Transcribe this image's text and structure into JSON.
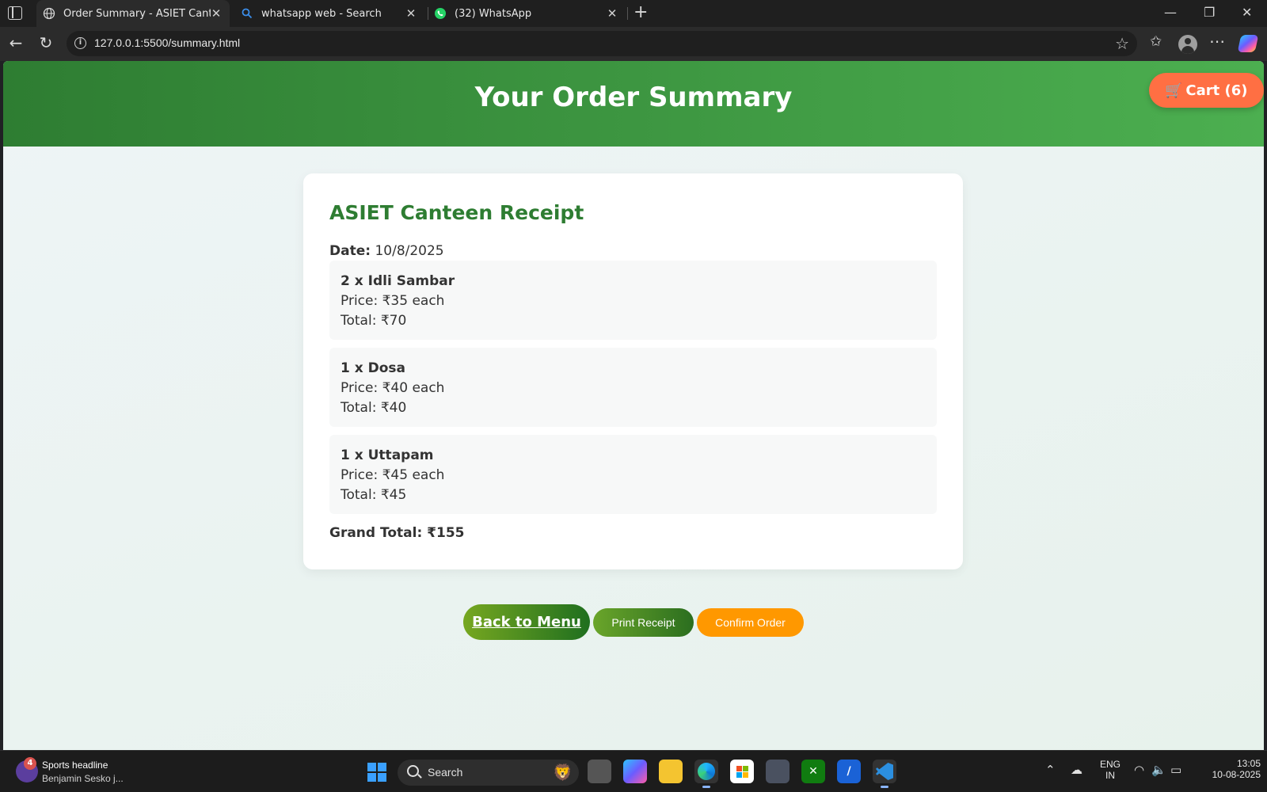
{
  "browser": {
    "tabs": [
      {
        "title": "Order Summary - ASIET Canteen",
        "icon": "globe-icon",
        "active": true
      },
      {
        "title": "whatsapp web - Search",
        "icon": "search-icon",
        "active": false
      },
      {
        "title": "(32) WhatsApp",
        "icon": "whatsapp-icon",
        "active": false
      }
    ],
    "url": "127.0.0.1:5500/summary.html"
  },
  "page": {
    "title": "Your Order Summary",
    "cart_label": "Cart (6)",
    "receipt": {
      "heading": "ASIET Canteen Receipt",
      "date_label": "Date:",
      "date_value": "10/8/2025",
      "items": [
        {
          "name": "2 x Idli Sambar",
          "price": "Price: ₹35 each",
          "total": "Total: ₹70"
        },
        {
          "name": "1 x Dosa",
          "price": "Price: ₹40 each",
          "total": "Total: ₹40"
        },
        {
          "name": "1 x Uttapam",
          "price": "Price: ₹45 each",
          "total": "Total: ₹45"
        }
      ],
      "grand_total": "Grand Total: ₹155"
    },
    "buttons": {
      "back": "Back to Menu",
      "print": "Print Receipt",
      "confirm": "Confirm Order"
    },
    "colors": {
      "header_start": "#2e7d32",
      "header_end": "#4caf50",
      "cart": "#ff6f43",
      "confirm": "#ff9800"
    }
  },
  "taskbar": {
    "widget_badge": "4",
    "widget_title": "Sports headline",
    "widget_subtitle": "Benjamin Sesko j...",
    "search_label": "Search",
    "language_line1": "ENG",
    "language_line2": "IN",
    "time": "13:05",
    "date": "10-08-2025"
  }
}
